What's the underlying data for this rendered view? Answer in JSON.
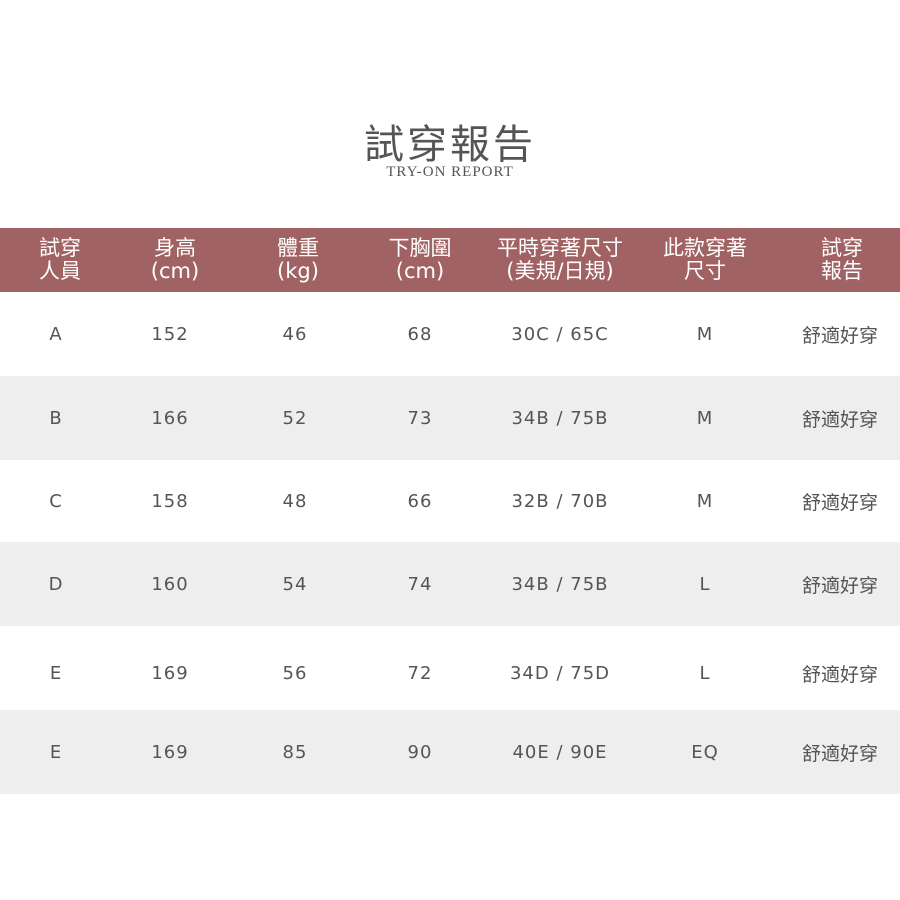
{
  "title": "試穿報告",
  "subtitle": "TRY-ON REPORT",
  "header": [
    {
      "line1": "試穿",
      "line2": "人員"
    },
    {
      "line1": "身高",
      "line2": "(cm)"
    },
    {
      "line1": "體重",
      "line2": "(kg)"
    },
    {
      "line1": "下胸圍",
      "line2": "(cm)"
    },
    {
      "line1": "平時穿著尺寸",
      "line2": "(美規/日規)"
    },
    {
      "line1": "此款穿著",
      "line2": "尺寸"
    },
    {
      "line1": "試穿",
      "line2": "報告"
    }
  ],
  "rows": [
    {
      "person": "A",
      "height": "152",
      "weight": "46",
      "underbust": "68",
      "usual_size": "30C / 65C",
      "size_worn": "M",
      "report": "舒適好穿"
    },
    {
      "person": "B",
      "height": "166",
      "weight": "52",
      "underbust": "73",
      "usual_size": "34B / 75B",
      "size_worn": "M",
      "report": "舒適好穿"
    },
    {
      "person": "C",
      "height": "158",
      "weight": "48",
      "underbust": "66",
      "usual_size": "32B / 70B",
      "size_worn": "M",
      "report": "舒適好穿"
    },
    {
      "person": "D",
      "height": "160",
      "weight": "54",
      "underbust": "74",
      "usual_size": "34B / 75B",
      "size_worn": "L",
      "report": "舒適好穿"
    },
    {
      "person": "E",
      "height": "169",
      "weight": "56",
      "underbust": "72",
      "usual_size": "34D / 75D",
      "size_worn": "L",
      "report": "舒適好穿"
    },
    {
      "person": "E",
      "height": "169",
      "weight": "85",
      "underbust": "90",
      "usual_size": "40E / 90E",
      "size_worn": "EQ",
      "report": "舒適好穿"
    }
  ],
  "colors": {
    "header_bg": "#a06262",
    "header_text": "#ffffff",
    "row_shade": "#eeeeee",
    "text": "#555555"
  }
}
